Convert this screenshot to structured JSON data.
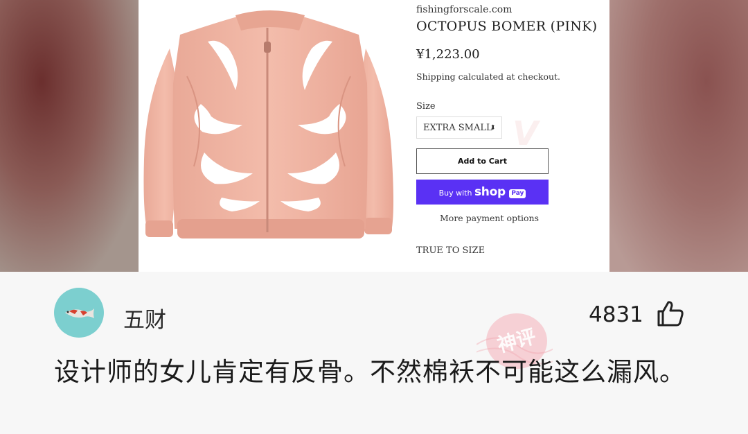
{
  "product": {
    "site": "fishingforscale.com",
    "title": "OCTOPUS BOMER (PINK)",
    "price": "¥1,223.00",
    "shipping": "Shipping calculated at checkout.",
    "size_label": "Size",
    "size_value": "EXTRA SMALL",
    "add_to_cart": "Add to Cart",
    "buy_with": "Buy with",
    "shop": "shop",
    "pay": "Pay",
    "more_payment": "More payment options",
    "true_to_size": "TRUE TO SIZE",
    "accent_color": "#5a31f4"
  },
  "comment": {
    "author": "五财",
    "likes": "4831",
    "text": "设计师的女儿肯定有反骨。不然棉袄不可能这么漏风。",
    "stamp_text": "神评",
    "avatar_icon": "koi-fish-icon",
    "like_icon": "thumbs-up-icon"
  }
}
